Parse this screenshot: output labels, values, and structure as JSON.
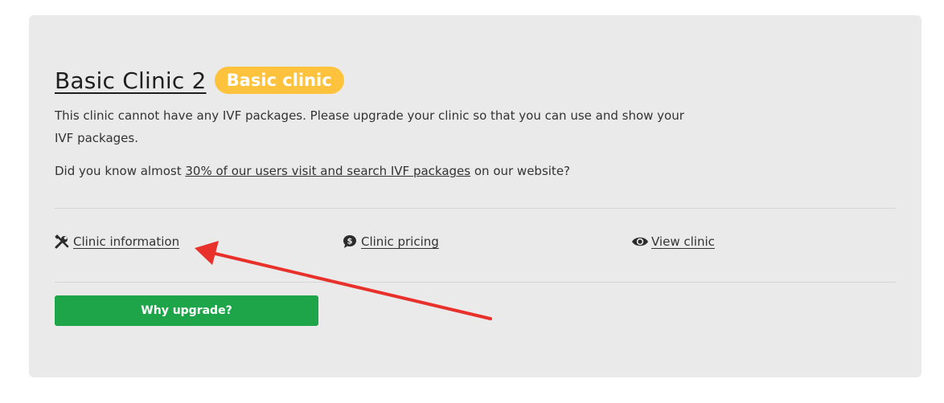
{
  "clinic": {
    "title": "Basic Clinic 2",
    "badge": "Basic clinic",
    "badge_color": "#ffc23d",
    "description": "This clinic cannot have any IVF packages. Please upgrade your clinic so that you can use and show your IVF packages.",
    "did_you_know_prefix": "Did you know almost ",
    "did_you_know_link": "30% of our users visit and search IVF packages",
    "did_you_know_suffix": " on our website?"
  },
  "links": [
    {
      "label": "Clinic information",
      "icon": "tools-icon"
    },
    {
      "label": "Clinic pricing",
      "icon": "dollar-bubble-icon"
    },
    {
      "label": "View clinic",
      "icon": "eye-icon"
    }
  ],
  "actions": {
    "upgrade_label": "Why upgrade?",
    "upgrade_color": "#1ea54a"
  },
  "annotation": {
    "arrow_color": "#e8312a"
  }
}
